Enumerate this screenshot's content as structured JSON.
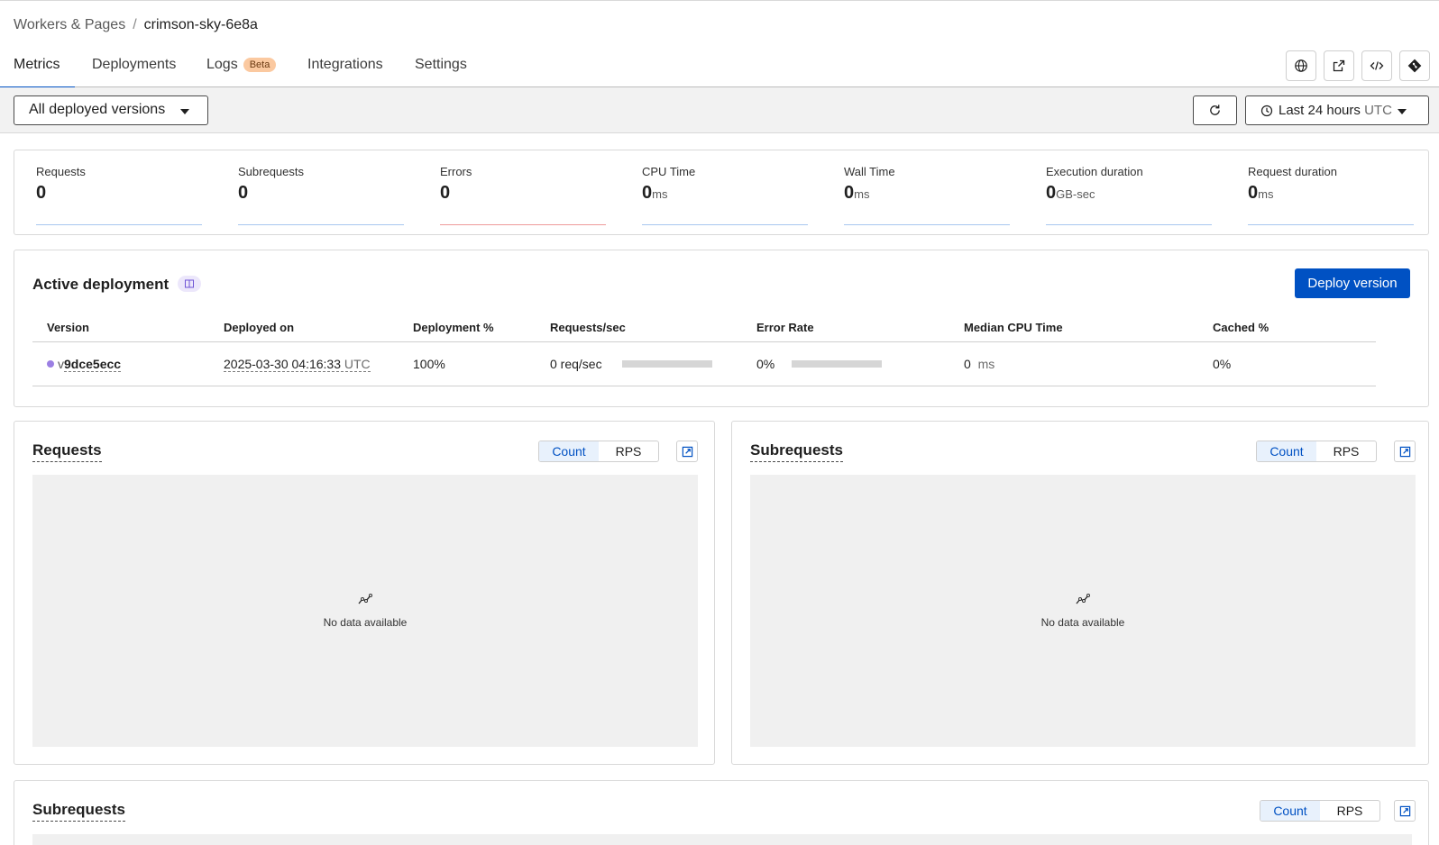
{
  "breadcrumb": {
    "parent": "Workers & Pages",
    "separator": "/",
    "current": "crimson-sky-6e8a"
  },
  "tabs": [
    {
      "label": "Metrics",
      "active": true
    },
    {
      "label": "Deployments"
    },
    {
      "label": "Logs",
      "badge": "Beta"
    },
    {
      "label": "Integrations"
    },
    {
      "label": "Settings"
    }
  ],
  "header_icons": [
    "globe-icon",
    "external-link-icon",
    "code-icon",
    "git-icon"
  ],
  "filters": {
    "version_select": "All deployed versions",
    "time_range": "Last 24 hours",
    "time_zone": "UTC"
  },
  "metrics": [
    {
      "label": "Requests",
      "value": "0",
      "unit": ""
    },
    {
      "label": "Subrequests",
      "value": "0",
      "unit": ""
    },
    {
      "label": "Errors",
      "value": "0",
      "unit": ""
    },
    {
      "label": "CPU Time",
      "value": "0",
      "unit": "ms"
    },
    {
      "label": "Wall Time",
      "value": "0",
      "unit": "ms"
    },
    {
      "label": "Execution duration",
      "value": "0",
      "unit": "GB-sec"
    },
    {
      "label": "Request duration",
      "value": "0",
      "unit": "ms"
    }
  ],
  "active_deployment": {
    "title": "Active deployment",
    "deploy_button": "Deploy version",
    "columns": [
      "Version",
      "Deployed on",
      "Deployment %",
      "Requests/sec",
      "Error Rate",
      "Median CPU Time",
      "Cached %"
    ],
    "row": {
      "version_prefix": "v",
      "version_id": "9dce5ecc",
      "deployed_on": "2025-03-30 04:16:33",
      "deployed_tz": "UTC",
      "deployment_pct": "100%",
      "requests_sec": "0 req/sec",
      "error_rate": "0%",
      "median_cpu": "0",
      "median_cpu_unit": "ms",
      "cached_pct": "0%"
    }
  },
  "charts": [
    {
      "title": "Requests",
      "toggle": [
        "Count",
        "RPS"
      ],
      "selected": "Count",
      "empty_text": "No data available"
    },
    {
      "title": "Subrequests",
      "toggle": [
        "Count",
        "RPS"
      ],
      "selected": "Count",
      "empty_text": "No data available"
    },
    {
      "title": "Subrequests",
      "toggle": [
        "Count",
        "RPS"
      ],
      "selected": "Count"
    }
  ],
  "colors": {
    "accent": "#0051c3",
    "version_dot": "#9b7fe3",
    "beta_badge": "#fbc9a0"
  }
}
